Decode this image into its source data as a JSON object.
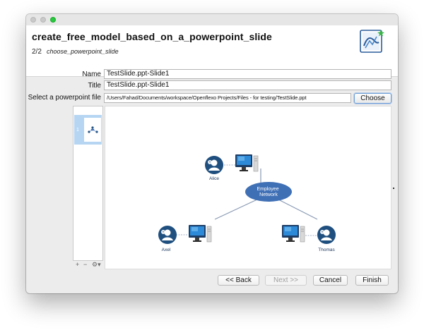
{
  "header": {
    "title": "create_free_model_based_on_a_powerpoint_slide",
    "step": "2/2",
    "step_name": "choose_powerpoint_slide"
  },
  "form": {
    "name_label": "Name",
    "name_value": "TestSlide.ppt-Slide1",
    "title_label": "Title",
    "title_value": "TestSlide.ppt-Slide1",
    "file_label": "Select a powerpoint file",
    "file_value": "/Users/Fahad/Documents/workspace/Openflexo Projects/Files - for testing/TestSlide.ppt",
    "choose_label": "Choose"
  },
  "slide_list": {
    "items": [
      {
        "number": "1"
      }
    ],
    "tools": {
      "add": "+",
      "remove": "−",
      "settings": "⚙▾"
    }
  },
  "slide": {
    "network_label": "Employee Network",
    "people": [
      {
        "name": "Alice"
      },
      {
        "name": "Axel"
      },
      {
        "name": "Thomas"
      }
    ]
  },
  "footer": {
    "back_label": "<< Back",
    "next_label": "Next >>",
    "cancel_label": "Cancel",
    "finish_label": "Finish"
  },
  "colors": {
    "accent": "#4a78b0",
    "person_icon": "#1f4f7f",
    "network_fill": "#3f6fb5"
  }
}
